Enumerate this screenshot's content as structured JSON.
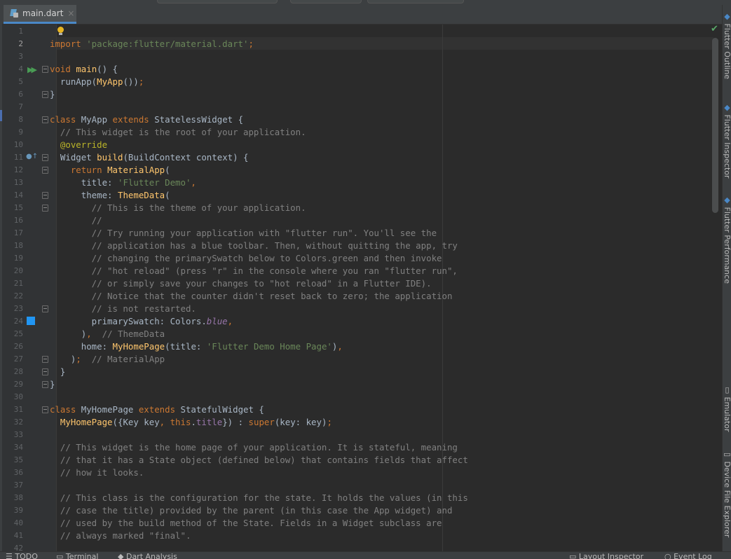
{
  "tab": {
    "label": "main.dart",
    "close_glyph": "×"
  },
  "gutter": {
    "line_numbers": [
      "1",
      "2",
      "3",
      "4",
      "5",
      "6",
      "7",
      "8",
      "9",
      "10",
      "11",
      "12",
      "13",
      "14",
      "15",
      "16",
      "17",
      "18",
      "19",
      "20",
      "21",
      "22",
      "23",
      "24",
      "25",
      "26",
      "27",
      "28",
      "29",
      "30",
      "31",
      "32",
      "33",
      "34",
      "35",
      "36",
      "37",
      "38",
      "39",
      "40",
      "41",
      "42"
    ],
    "active_line": "2"
  },
  "code_lines": [
    [],
    [
      {
        "t": "kw",
        "v": "import "
      },
      {
        "t": "str",
        "v": "'package:flutter/material.dart'"
      },
      {
        "t": "kw",
        "v": ";"
      }
    ],
    [],
    [
      {
        "t": "kw",
        "v": "void "
      },
      {
        "t": "fn",
        "v": "main"
      },
      {
        "t": "",
        "v": "() {"
      }
    ],
    [
      {
        "t": "",
        "v": "  runApp("
      },
      {
        "t": "fn",
        "v": "MyApp"
      },
      {
        "t": "",
        "v": "())"
      },
      {
        "t": "kw",
        "v": ";"
      }
    ],
    [
      {
        "t": "",
        "v": "}"
      }
    ],
    [],
    [
      {
        "t": "kw",
        "v": "class "
      },
      {
        "t": "",
        "v": "MyApp "
      },
      {
        "t": "kw",
        "v": "extends "
      },
      {
        "t": "",
        "v": "StatelessWidget {"
      }
    ],
    [
      {
        "t": "cmt",
        "v": "  // This widget is the root of your application."
      }
    ],
    [
      {
        "t": "ann",
        "v": "  @override"
      }
    ],
    [
      {
        "t": "",
        "v": "  Widget "
      },
      {
        "t": "fn",
        "v": "build"
      },
      {
        "t": "",
        "v": "(BuildContext context) {"
      }
    ],
    [
      {
        "t": "kw",
        "v": "    return "
      },
      {
        "t": "fn",
        "v": "MaterialApp"
      },
      {
        "t": "",
        "v": "("
      }
    ],
    [
      {
        "t": "",
        "v": "      title: "
      },
      {
        "t": "str",
        "v": "'Flutter Demo'"
      },
      {
        "t": "kw",
        "v": ","
      }
    ],
    [
      {
        "t": "",
        "v": "      theme: "
      },
      {
        "t": "fn",
        "v": "ThemeData"
      },
      {
        "t": "",
        "v": "("
      }
    ],
    [
      {
        "t": "cmt",
        "v": "        // This is the theme of your application."
      }
    ],
    [
      {
        "t": "cmt",
        "v": "        //"
      }
    ],
    [
      {
        "t": "cmt",
        "v": "        // Try running your application with \"flutter run\". You'll see the"
      }
    ],
    [
      {
        "t": "cmt",
        "v": "        // application has a blue toolbar. Then, without quitting the app, try"
      }
    ],
    [
      {
        "t": "cmt",
        "v": "        // changing the primarySwatch below to Colors.green and then invoke"
      }
    ],
    [
      {
        "t": "cmt",
        "v": "        // \"hot reload\" (press \"r\" in the console where you ran \"flutter run\","
      }
    ],
    [
      {
        "t": "cmt",
        "v": "        // or simply save your changes to \"hot reload\" in a Flutter IDE)."
      }
    ],
    [
      {
        "t": "cmt",
        "v": "        // Notice that the counter didn't reset back to zero; the application"
      }
    ],
    [
      {
        "t": "cmt",
        "v": "        // is not restarted."
      }
    ],
    [
      {
        "t": "",
        "v": "        primarySwatch: Colors."
      },
      {
        "t": "ital",
        "v": "blue"
      },
      {
        "t": "kw",
        "v": ","
      }
    ],
    [
      {
        "t": "",
        "v": "      )"
      },
      {
        "t": "kw",
        "v": ","
      },
      {
        "t": "cmt",
        "v": "  // ThemeData"
      }
    ],
    [
      {
        "t": "",
        "v": "      home: "
      },
      {
        "t": "fn",
        "v": "MyHomePage"
      },
      {
        "t": "",
        "v": "(title: "
      },
      {
        "t": "str",
        "v": "'Flutter Demo Home Page'"
      },
      {
        "t": "",
        "v": ")"
      },
      {
        "t": "kw",
        "v": ","
      }
    ],
    [
      {
        "t": "",
        "v": "    )"
      },
      {
        "t": "kw",
        "v": ";"
      },
      {
        "t": "cmt",
        "v": "  // MaterialApp"
      }
    ],
    [
      {
        "t": "",
        "v": "  }"
      }
    ],
    [
      {
        "t": "",
        "v": "}"
      }
    ],
    [],
    [
      {
        "t": "kw",
        "v": "class "
      },
      {
        "t": "",
        "v": "MyHomePage "
      },
      {
        "t": "kw",
        "v": "extends "
      },
      {
        "t": "",
        "v": "StatefulWidget {"
      }
    ],
    [
      {
        "t": "fn",
        "v": "  MyHomePage"
      },
      {
        "t": "",
        "v": "({Key key"
      },
      {
        "t": "kw",
        "v": ", this"
      },
      {
        "t": "",
        "v": "."
      },
      {
        "t": "fld",
        "v": "title"
      },
      {
        "t": "",
        "v": "}) : "
      },
      {
        "t": "kw",
        "v": "super"
      },
      {
        "t": "",
        "v": "(key: key)"
      },
      {
        "t": "kw",
        "v": ";"
      }
    ],
    [],
    [
      {
        "t": "cmt",
        "v": "  // This widget is the home page of your application. It is stateful, meaning"
      }
    ],
    [
      {
        "t": "cmt",
        "v": "  // that it has a State object (defined below) that contains fields that affect"
      }
    ],
    [
      {
        "t": "cmt",
        "v": "  // how it looks."
      }
    ],
    [],
    [
      {
        "t": "cmt",
        "v": "  // This class is the configuration for the state. It holds the values (in this"
      }
    ],
    [
      {
        "t": "cmt",
        "v": "  // case the title) provided by the parent (in this case the App widget) and"
      }
    ],
    [
      {
        "t": "cmt",
        "v": "  // used by the build method of the State. Fields in a Widget subclass are"
      }
    ],
    [
      {
        "t": "cmt",
        "v": "  // always marked \"final\"."
      }
    ],
    []
  ],
  "right_toolbar": {
    "flutter_outline": "Flutter Outline",
    "flutter_inspector": "Flutter Inspector",
    "flutter_performance": "Flutter Performance",
    "emulator": "Emulator",
    "device_file_explorer": "Device File Explorer"
  },
  "bottom_toolbar": {
    "todo": "TODO",
    "terminal": "Terminal",
    "dart_analysis": "Dart Analysis",
    "layout_inspector": "Layout Inspector",
    "event_log": "Event Log"
  },
  "colors": {
    "background": "#2b2b2b",
    "keyword": "#cc7832",
    "string": "#6a8759",
    "comment": "#808080",
    "function": "#ffc66d",
    "annotation": "#bbb529",
    "swatch_blue": "#2196f3"
  }
}
